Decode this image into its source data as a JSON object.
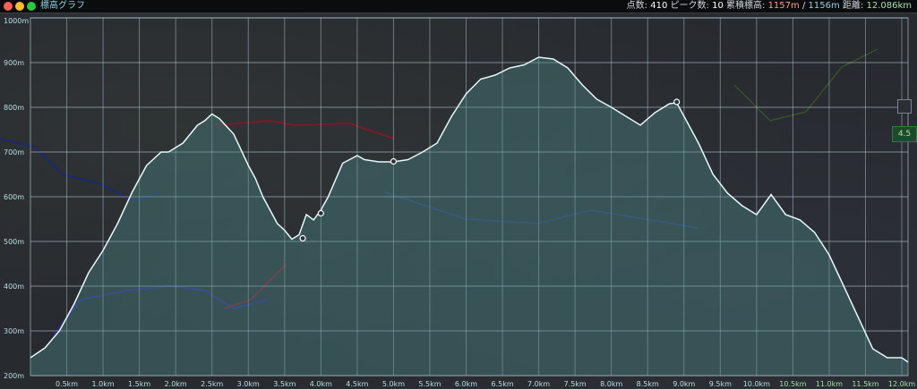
{
  "window": {
    "title": "標高グラフ",
    "controls": [
      {
        "name": "close",
        "color": "#ff5f57"
      },
      {
        "name": "minimize",
        "color": "#febc2e"
      },
      {
        "name": "zoom",
        "color": "#28c840"
      }
    ]
  },
  "stats": {
    "points_label": "点数:",
    "points_value": "410",
    "peaks_label": "ピーク数:",
    "peaks_value": "10",
    "gain_label": "累積標高:",
    "gain_up": "1157m",
    "gain_sep": "/",
    "gain_down": "1156m",
    "distance_label": "距離:",
    "distance_value": "12.086km",
    "colors": {
      "up": "#ff9a8a",
      "down": "#8fd1e0",
      "distance": "#9fe0a8"
    }
  },
  "map_badge": "4.5",
  "chart_data": {
    "type": "area",
    "xlabel": "",
    "ylabel": "",
    "xlim": [
      0,
      12.086
    ],
    "ylim": [
      200,
      1000
    ],
    "y_ticks": [
      "1000m",
      "900m",
      "800m",
      "700m",
      "600m",
      "500m",
      "400m",
      "300m",
      "200m"
    ],
    "y_tick_values": [
      1000,
      900,
      800,
      700,
      600,
      500,
      400,
      300,
      200
    ],
    "x_ticks": [
      "0.5km",
      "1.0km",
      "1.5km",
      "2.0km",
      "2.5km",
      "3.0km",
      "3.5km",
      "4.0km",
      "4.5km",
      "5.0km",
      "5.5km",
      "6.0km",
      "6.5km",
      "7.0km",
      "7.5km",
      "8.0km",
      "8.5km",
      "9.0km",
      "9.5km",
      "10.0km",
      "10.5km",
      "11.0km",
      "11.5km",
      "12.0km"
    ],
    "x_tick_values": [
      0.5,
      1.0,
      1.5,
      2.0,
      2.5,
      3.0,
      3.5,
      4.0,
      4.5,
      5.0,
      5.5,
      6.0,
      6.5,
      7.0,
      7.5,
      8.0,
      8.5,
      9.0,
      9.5,
      10.0,
      10.5,
      11.0,
      11.5,
      12.0
    ],
    "grid": true,
    "line_color": "#e6f6f8",
    "fill_color": "#4f8f8f",
    "series": [
      {
        "x": [
          0.0,
          0.2,
          0.4,
          0.6,
          0.8,
          1.0,
          1.2,
          1.4,
          1.6,
          1.8,
          1.9,
          2.1,
          2.3,
          2.4,
          2.5,
          2.6,
          2.8,
          3.0,
          3.1,
          3.2,
          3.3,
          3.4,
          3.5,
          3.6,
          3.7,
          3.8,
          3.9,
          4.0,
          4.1,
          4.3,
          4.5,
          4.6,
          4.8,
          5.0,
          5.2,
          5.4,
          5.6,
          5.8,
          6.0,
          6.2,
          6.4,
          6.6,
          6.8,
          7.0,
          7.2,
          7.4,
          7.6,
          7.8,
          8.0,
          8.2,
          8.4,
          8.6,
          8.8,
          8.9,
          9.0,
          9.2,
          9.4,
          9.6,
          9.8,
          10.0,
          10.2,
          10.4,
          10.6,
          10.8,
          11.0,
          11.2,
          11.4,
          11.6,
          11.8,
          12.0,
          12.086
        ],
        "y": [
          240,
          262,
          300,
          360,
          430,
          480,
          540,
          610,
          670,
          700,
          700,
          720,
          760,
          770,
          785,
          775,
          740,
          670,
          640,
          600,
          570,
          540,
          525,
          505,
          515,
          560,
          548,
          570,
          600,
          675,
          692,
          683,
          678,
          678,
          683,
          700,
          720,
          780,
          830,
          863,
          872,
          888,
          895,
          912,
          908,
          888,
          850,
          818,
          800,
          780,
          760,
          788,
          808,
          810,
          780,
          720,
          650,
          608,
          580,
          560,
          605,
          560,
          548,
          520,
          470,
          400,
          330,
          260,
          240,
          240,
          230
        ],
        "markers": [
          {
            "x": 3.75,
            "y": 507
          },
          {
            "x": 4.0,
            "y": 563
          },
          {
            "x": 5.0,
            "y": 679
          },
          {
            "x": 8.9,
            "y": 812
          }
        ]
      }
    ]
  }
}
